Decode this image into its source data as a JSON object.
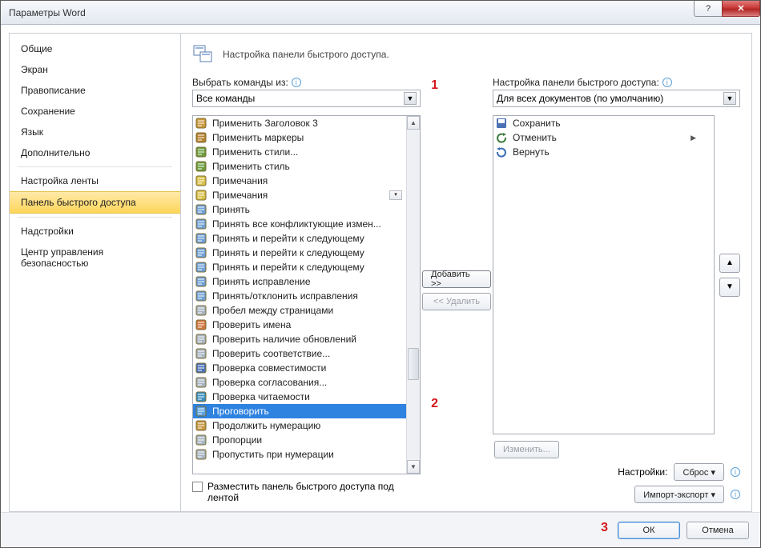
{
  "window": {
    "title": "Параметры Word"
  },
  "sidebar": {
    "items": [
      {
        "label": "Общие"
      },
      {
        "label": "Экран"
      },
      {
        "label": "Правописание"
      },
      {
        "label": "Сохранение"
      },
      {
        "label": "Язык"
      },
      {
        "label": "Дополнительно"
      },
      {
        "label": "Настройка ленты"
      },
      {
        "label": "Панель быстрого доступа",
        "selected": true
      },
      {
        "label": "Надстройки"
      },
      {
        "label": "Центр управления безопасностью"
      }
    ]
  },
  "heading": "Настройка панели быстрого доступа.",
  "left": {
    "label": "Выбрать команды из:",
    "dropdown": "Все команды"
  },
  "right": {
    "label": "Настройка панели быстрого доступа:",
    "dropdown": "Для всех документов (по умолчанию)"
  },
  "commands": [
    "Применить Заголовок 3",
    "Применить маркеры",
    "Применить стили...",
    "Применить стиль",
    "Примечания",
    "Примечания",
    "Принять",
    "Принять все конфликтующие измен...",
    "Принять и перейти к следующему",
    "Принять и перейти к следующему",
    "Принять и перейти к следующему",
    "Принять исправление",
    "Принять/отклонить исправления",
    "Пробел между страницами",
    "Проверить имена",
    "Проверить наличие обновлений",
    "Проверить соответствие...",
    "Проверка совместимости",
    "Проверка согласования...",
    "Проверка читаемости",
    "Проговорить",
    "Продолжить нумерацию",
    "Пропорции",
    "Пропустить при нумерации"
  ],
  "commands_selected_index": 20,
  "qat": [
    {
      "label": "Сохранить"
    },
    {
      "label": "Отменить",
      "submenu": true
    },
    {
      "label": "Вернуть"
    }
  ],
  "buttons": {
    "add": "Добавить >>",
    "remove": "<< Удалить",
    "modify": "Изменить...",
    "reset": "Сброс ▾",
    "importexport": "Импорт-экспорт ▾",
    "ok": "ОК",
    "cancel": "Отмена"
  },
  "labels": {
    "below_ribbon": "Разместить панель быстрого доступа под лентой",
    "settings": "Настройки:"
  },
  "annotations": {
    "num1": "1",
    "num2": "2",
    "num3": "3"
  }
}
